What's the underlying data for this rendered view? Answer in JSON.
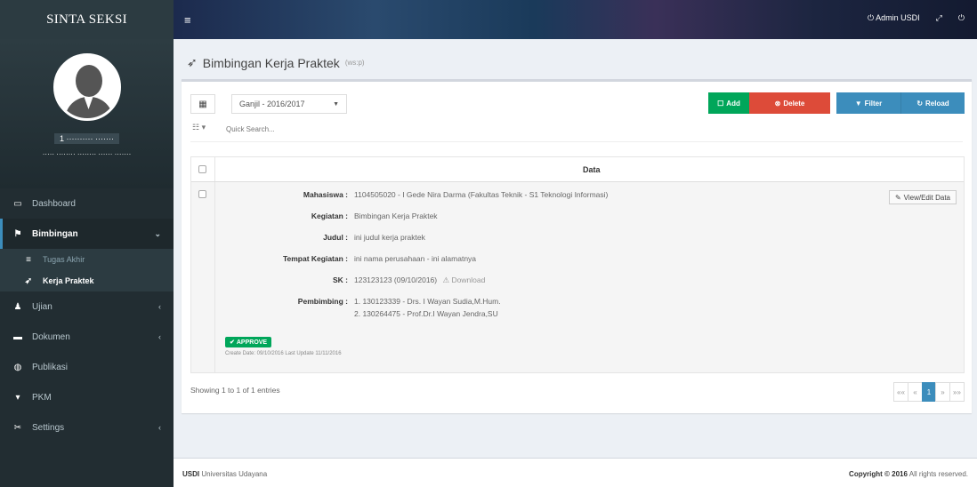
{
  "app": {
    "brand": "SINTA SEKSI"
  },
  "user": {
    "id": "1 ·········· ·······",
    "role": "····· ········ ········\n······ ·······"
  },
  "sidebar": {
    "items": [
      {
        "label": "Dashboard",
        "icon": "monitor-icon"
      },
      {
        "label": "Bimbingan",
        "icon": "flag-icon"
      },
      {
        "label": "Ujian",
        "icon": "user-icon"
      },
      {
        "label": "Dokumen",
        "icon": "folder-icon"
      },
      {
        "label": "Publikasi",
        "icon": "globe-icon"
      },
      {
        "label": "PKM",
        "icon": "trophy-icon"
      },
      {
        "label": "Settings",
        "icon": "wrench-icon"
      }
    ],
    "submenu": [
      {
        "label": "Tugas Akhir"
      },
      {
        "label": "Kerja Praktek"
      }
    ]
  },
  "header": {
    "user_label": "Admin USDI"
  },
  "page": {
    "title": "Bimbingan Kerja Praktek",
    "subtitle": "(ws:p)"
  },
  "toolbar": {
    "semester": "Ganjil - 2016/2017",
    "add_label": "Add",
    "delete_label": "Delete",
    "filter_label": "Filter",
    "reload_label": "Reload",
    "search_placeholder": "Quick Search..."
  },
  "table": {
    "header": "Data",
    "row": {
      "labels": {
        "mahasiswa": "Mahasiswa :",
        "kegiatan": "Kegiatan :",
        "judul": "Judul :",
        "tempat": "Tempat Kegiatan :",
        "sk": "SK :",
        "pembimbing": "Pembimbing :"
      },
      "values": {
        "mahasiswa": "1104505020 - I Gede Nira Darma (Fakultas Teknik - S1 Teknologi Informasi)",
        "kegiatan": "Bimbingan Kerja Praktek",
        "judul": "ini judul kerja praktek",
        "tempat": "ini nama perusahaan - ini alamatnya",
        "sk": "123123123 (09/10/2016)",
        "sk_download": "Download",
        "pembimbing_1": "1. 130123339 - Drs. I Wayan Sudia,M.Hum.",
        "pembimbing_2": "2. 130264475 - Prof.Dr.I Wayan Jendra,SU"
      },
      "view_label": "View/Edit Data",
      "status": "APPROVE",
      "meta": "Create Date: 09/10/2016  Last Update 11/11/2016"
    }
  },
  "footer_info": {
    "showing": "Showing 1 to 1 of 1 entries"
  },
  "pagination": {
    "first": "««",
    "prev": "«",
    "current": "1",
    "next": "»",
    "last": "»»"
  },
  "footer": {
    "left_bold": "USDI",
    "left": " Universitas Udayana",
    "right_bold": "Copyright © 2016",
    "right": " All rights reserved."
  },
  "colors": {
    "sidebar": "#222d32",
    "green": "#00a65a",
    "red": "#dd4b39",
    "blue": "#3c8dbc"
  }
}
